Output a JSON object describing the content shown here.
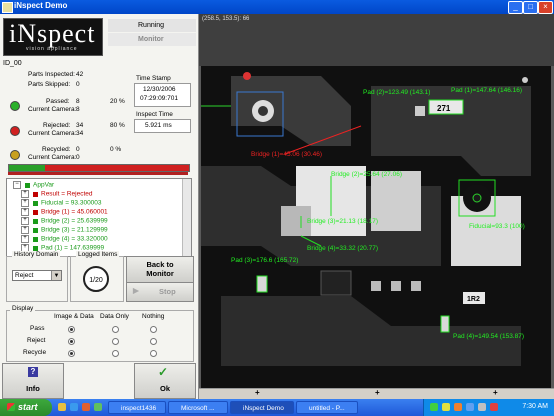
{
  "window": {
    "title": "iNspect Demo"
  },
  "logo": {
    "text": "iNspect",
    "tagline": "vision appliance"
  },
  "status": {
    "running": "Running",
    "monitor": "Monitor"
  },
  "job_id": "ID_00",
  "stats": {
    "parts_inspected_label": "Parts Inspected:",
    "parts_inspected": "42",
    "parts_skipped_label": "Parts Skipped:",
    "parts_skipped": "0",
    "passed_label": "Passed:",
    "passed": "8",
    "passed_pct": "20 %",
    "current_camera_label": "Current Camera:",
    "current_camera_passed": "8",
    "rejected_label": "Rejected:",
    "rejected": "34",
    "rejected_pct": "80 %",
    "current_camera_rejected": "34",
    "recycled_label": "Recycled:",
    "recycled": "0",
    "recycled_pct": "0 %",
    "current_camera_recycled": "0",
    "time_stamp_label": "Time Stamp",
    "date": "12/30/2006",
    "time": "07:29:09:701",
    "inspect_time_label": "Inspect Time",
    "inspect_time": "5.921 ms",
    "pass_fraction": 0.2
  },
  "tree": {
    "items": [
      {
        "text": "AppVar",
        "color": "#1a9a1a"
      },
      {
        "text": "Result = Rejected",
        "color": "#c00000"
      },
      {
        "text": "Fiducial = 93.300003",
        "color": "#1a9a1a"
      },
      {
        "text": "Bridge (1) = 45.060001",
        "color": "#c00000"
      },
      {
        "text": "Bridge (2) = 25.639999",
        "color": "#1a9a1a"
      },
      {
        "text": "Bridge (3) = 21.129999",
        "color": "#1a9a1a"
      },
      {
        "text": "Bridge (4) = 33.320000",
        "color": "#1a9a1a"
      },
      {
        "text": "Pad (1) = 147.639999",
        "color": "#1a9a1a"
      }
    ]
  },
  "history": {
    "label": "History Domain",
    "value": "Reject"
  },
  "logged": {
    "label": "Logged Items",
    "value": "1/20"
  },
  "buttons": {
    "back_to_monitor": "Back to Monitor",
    "stop": "Stop",
    "info": "Info",
    "ok": "Ok"
  },
  "display": {
    "label": "Display",
    "columns": [
      "Image & Data",
      "Data Only",
      "Nothing"
    ],
    "rows": [
      "Pass",
      "Reject",
      "Recycle"
    ]
  },
  "image": {
    "coords": "(258.5, 153.5): 66",
    "annotations": [
      {
        "text": "Pad (1)=147.64 (146.16)",
        "color": "#22ee22"
      },
      {
        "text": "Pad (2)=123.49 (143.1)",
        "color": "#22ee22"
      },
      {
        "text": "Bridge (1)=45.06 (30.46)",
        "color": "#ee2222"
      },
      {
        "text": "Bridge (2)=25.64 (27.06)",
        "color": "#22ee22"
      },
      {
        "text": "Bridge (3)=21.13 (18.17)",
        "color": "#22ee22"
      },
      {
        "text": "Bridge (4)=33.32 (20.77)",
        "color": "#22ee22"
      },
      {
        "text": "Fiducial=93.3 (100)",
        "color": "#22ee22"
      },
      {
        "text": "Pad (3)=176.6 (165.72)",
        "color": "#22ee22"
      },
      {
        "text": "Pad (4)=149.54 (153.87)",
        "color": "#22ee22"
      },
      {
        "text": "271",
        "color": "#ffffff"
      },
      {
        "text": "1R2",
        "color": "#ffffff"
      }
    ]
  },
  "taskbar": {
    "start": "start",
    "items": [
      "inspect1436",
      "Microsoft ...",
      "iNspect Demo",
      "untitled - P..."
    ],
    "clock": "7:30 AM"
  }
}
